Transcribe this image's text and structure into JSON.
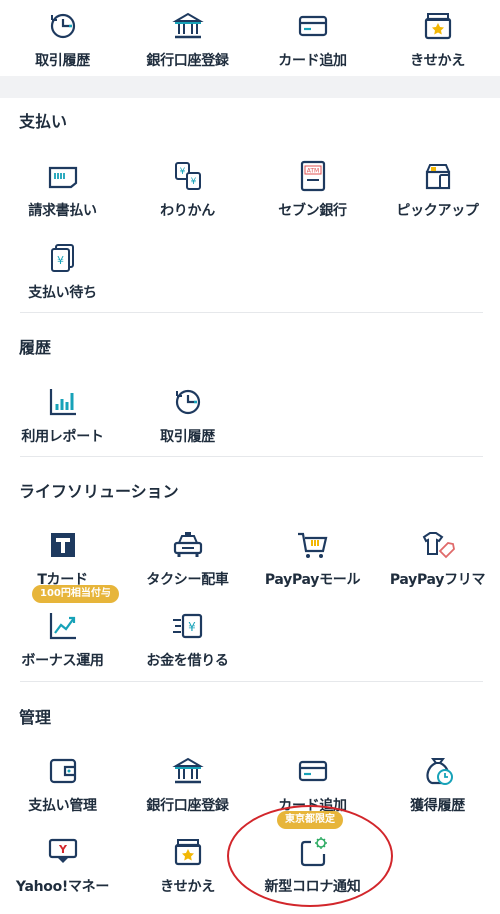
{
  "top_row": [
    {
      "label": "取引履歴",
      "icon": "history-clock-icon"
    },
    {
      "label": "銀行口座登録",
      "icon": "bank-icon"
    },
    {
      "label": "カード追加",
      "icon": "card-icon"
    },
    {
      "label": "きせかえ",
      "icon": "theme-icon"
    }
  ],
  "sections": {
    "payment": {
      "title": "支払い",
      "items": [
        {
          "label": "請求書払い",
          "icon": "invoice-icon"
        },
        {
          "label": "わりかん",
          "icon": "split-bill-icon"
        },
        {
          "label": "セブン銀行",
          "icon": "atm-icon"
        },
        {
          "label": "ピックアップ",
          "icon": "pickup-icon"
        },
        {
          "label": "支払い待ち",
          "icon": "pending-payment-icon"
        }
      ]
    },
    "history": {
      "title": "履歴",
      "items": [
        {
          "label": "利用レポート",
          "icon": "usage-report-icon"
        },
        {
          "label": "取引履歴",
          "icon": "history-clock-icon"
        }
      ]
    },
    "life": {
      "title": "ライフソリューション",
      "items": [
        {
          "label": "Tカード",
          "icon": "tcard-icon"
        },
        {
          "label": "タクシー配車",
          "icon": "taxi-icon"
        },
        {
          "label": "PayPayモール",
          "icon": "cart-icon"
        },
        {
          "label": "PayPayフリマ",
          "icon": "flea-market-icon"
        },
        {
          "label": "ボーナス運用",
          "icon": "investment-icon",
          "badge": "100円相当付与"
        },
        {
          "label": "お金を借りる",
          "icon": "borrow-money-icon"
        }
      ]
    },
    "manage": {
      "title": "管理",
      "items": [
        {
          "label": "支払い管理",
          "icon": "wallet-icon"
        },
        {
          "label": "銀行口座登録",
          "icon": "bank-icon"
        },
        {
          "label": "カード追加",
          "icon": "card-icon"
        },
        {
          "label": "獲得履歴",
          "icon": "rewards-history-icon"
        },
        {
          "label": "Yahoo!マネー",
          "icon": "yahoo-money-icon"
        },
        {
          "label": "きせかえ",
          "icon": "theme-icon"
        },
        {
          "label": "新型コロナ通知",
          "icon": "covid-notify-icon",
          "badge": "東京都限定"
        }
      ]
    }
  },
  "colors": {
    "navy": "#1e3a5f",
    "teal": "#17a2b8",
    "gold": "#f2b705",
    "red": "#d2262b",
    "badge": "#e7b53a"
  }
}
